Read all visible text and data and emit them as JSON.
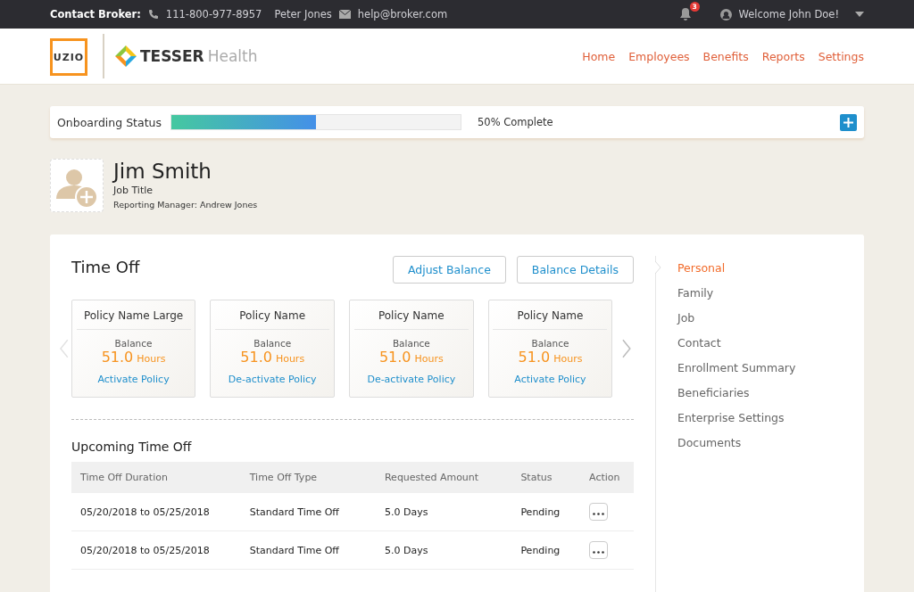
{
  "top_bar": {
    "contact_label": "Contact Broker:",
    "phone": "111-800-977-8957",
    "broker_name": "Peter Jones",
    "email": "help@broker.com",
    "notification_count": "3",
    "welcome": "Welcome John Doe!"
  },
  "header": {
    "logo_text": "UZIO",
    "partner_name": "TESSER",
    "partner_suffix": "Health",
    "nav": [
      {
        "label": "Home"
      },
      {
        "label": "Employees"
      },
      {
        "label": "Benefits"
      },
      {
        "label": "Reports"
      },
      {
        "label": "Settings"
      }
    ]
  },
  "onboarding": {
    "label": "Onboarding Status",
    "level": 0.5,
    "reading": "50% Complete"
  },
  "profile": {
    "name": "Jim Smith",
    "job_title": "Job Title",
    "manager": "Reporting Manager: Andrew Jones"
  },
  "time_off": {
    "title": "Time Off",
    "buttons": [
      "Adjust Balance",
      "Balance Details"
    ],
    "policies": [
      {
        "name": "Policy Name Large",
        "balance_label": "Balance",
        "amount": "51.0",
        "unit": "Hours",
        "action": "Activate Policy"
      },
      {
        "name": "Policy Name",
        "balance_label": "Balance",
        "amount": "51.0",
        "unit": "Hours",
        "action": "De-activate Policy"
      },
      {
        "name": "Policy Name",
        "balance_label": "Balance",
        "amount": "51.0",
        "unit": "Hours",
        "action": "De-activate Policy"
      },
      {
        "name": "Policy Name",
        "balance_label": "Balance",
        "amount": "51.0",
        "unit": "Hours",
        "action": "Activate Policy"
      }
    ]
  },
  "upcoming": {
    "title": "Upcoming Time Off",
    "columns": [
      "Time Off Duration",
      "Time Off Type",
      "Requested Amount",
      "Status",
      "Action"
    ],
    "rows": [
      {
        "duration": "05/20/2018 to 05/25/2018",
        "type": "Standard Time Off",
        "amount": "5.0 Days",
        "status": "Pending"
      },
      {
        "duration": "05/20/2018 to 05/25/2018",
        "type": "Standard Time Off",
        "amount": "5.0 Days",
        "status": "Pending"
      }
    ]
  },
  "side_nav": [
    {
      "label": "Personal",
      "selected": true
    },
    {
      "label": "Family",
      "selected": false
    },
    {
      "label": "Job",
      "selected": false
    },
    {
      "label": "Contact",
      "selected": false
    },
    {
      "label": "Enrollment Summary",
      "selected": false
    },
    {
      "label": "Beneficiaries",
      "selected": false
    },
    {
      "label": "Enterprise Settings",
      "selected": false
    },
    {
      "label": "Documents",
      "selected": false
    }
  ]
}
